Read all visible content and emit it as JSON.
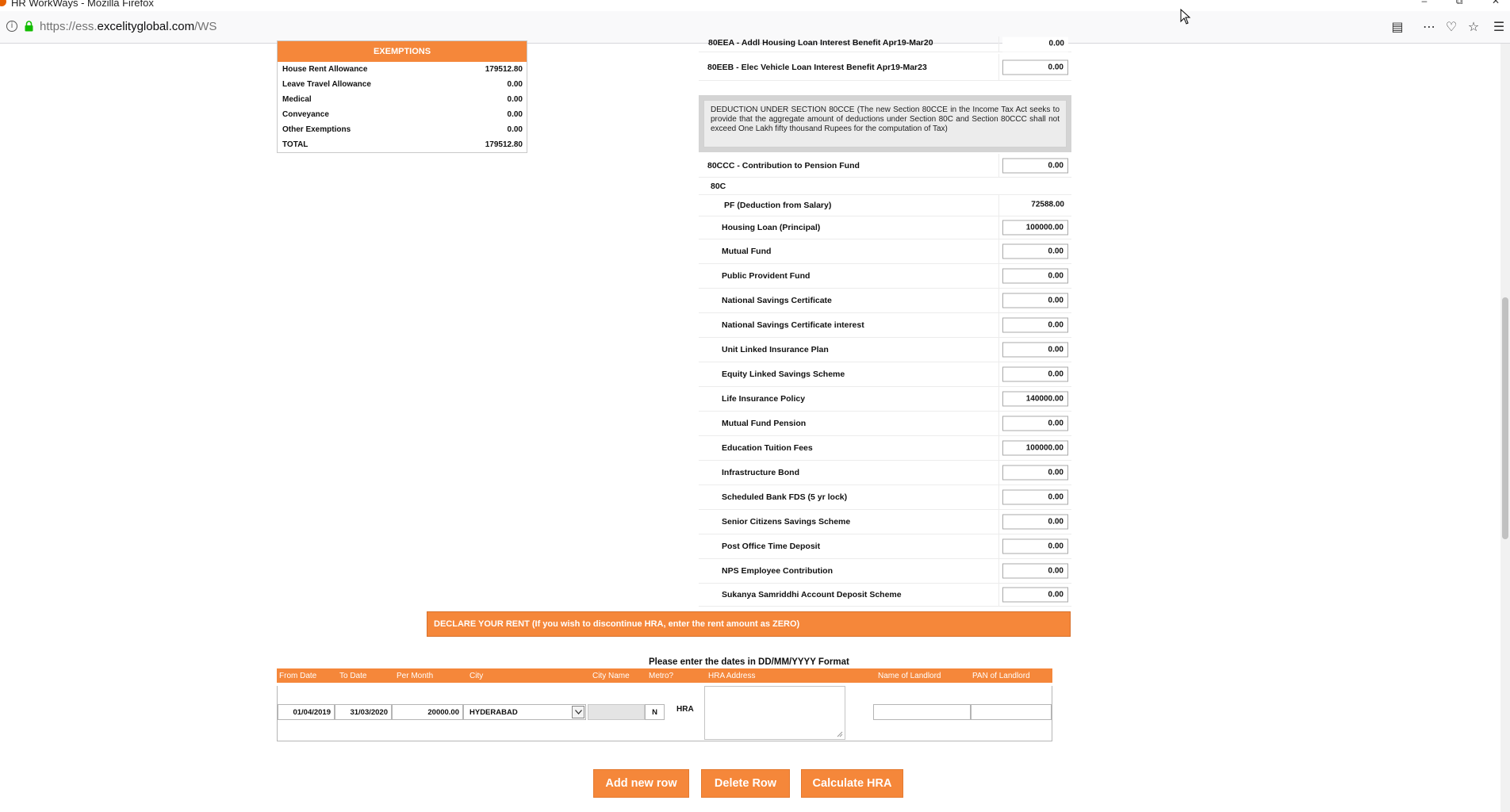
{
  "window": {
    "title": "HR WorkWays - Mozilla Firefox",
    "url_prefix": "https://ess.",
    "url_domain": "excelityglobal.com",
    "url_path": "/WS"
  },
  "exemptions": {
    "heading": "EXEMPTIONS",
    "rows": [
      {
        "label": "House Rent Allowance",
        "value": "179512.80"
      },
      {
        "label": "Leave Travel Allowance",
        "value": "0.00"
      },
      {
        "label": "Medical",
        "value": "0.00"
      },
      {
        "label": "Conveyance",
        "value": "0.00"
      },
      {
        "label": "Other Exemptions",
        "value": "0.00"
      },
      {
        "label": "TOTAL",
        "value": "179512.80"
      }
    ]
  },
  "deductions": {
    "top_partial": {
      "label": "80EEA - Addl Housing Loan Interest Benefit Apr19-Mar20",
      "value": "0.00"
    },
    "eeb": {
      "label": "80EEB - Elec Vehicle Loan Interest Benefit Apr19-Mar23",
      "value": "0.00"
    },
    "note": "DEDUCTION UNDER SECTION 80CCE (The new Section 80CCE in the Income Tax Act seeks to provide that the aggregate amount of deductions under Section 80C and Section 80CCC shall not exceed One Lakh fifty thousand Rupees for the computation of Tax)",
    "ccc": {
      "label": "80CCC - Contribution to Pension Fund",
      "value": "0.00"
    },
    "section_80c_label": "80C",
    "pf": {
      "label": "PF (Deduction from Salary)",
      "value": "72588.00"
    },
    "items": [
      {
        "label": "Housing Loan (Principal)",
        "value": "100000.00"
      },
      {
        "label": "Mutual Fund",
        "value": "0.00"
      },
      {
        "label": "Public Provident Fund",
        "value": "0.00"
      },
      {
        "label": "National Savings Certificate",
        "value": "0.00"
      },
      {
        "label": "National Savings Certificate interest",
        "value": "0.00"
      },
      {
        "label": "Unit Linked Insurance Plan",
        "value": "0.00"
      },
      {
        "label": "Equity Linked Savings Scheme",
        "value": "0.00"
      },
      {
        "label": "Life Insurance Policy",
        "value": "140000.00"
      },
      {
        "label": "Mutual Fund Pension",
        "value": "0.00"
      },
      {
        "label": "Education Tuition Fees",
        "value": "100000.00"
      },
      {
        "label": "Infrastructure Bond",
        "value": "0.00"
      },
      {
        "label": "Scheduled Bank FDS (5 yr lock)",
        "value": "0.00"
      },
      {
        "label": "Senior Citizens Savings Scheme",
        "value": "0.00"
      },
      {
        "label": "Post Office Time Deposit",
        "value": "0.00"
      },
      {
        "label": "NPS Employee Contribution",
        "value": "0.00"
      },
      {
        "label": "Sukanya Samriddhi Account Deposit Scheme",
        "value": "0.00"
      }
    ]
  },
  "rent": {
    "banner": "DECLARE YOUR RENT (If you wish to discontinue HRA, enter the rent amount as ZERO)",
    "date_note": "Please enter the dates in DD/MM/YYYY Format",
    "headers": {
      "from_date": "From Date",
      "to_date": "To Date",
      "per_month": "Per Month",
      "city": "City",
      "city_name": "City Name",
      "metro": "Metro?",
      "hra_address": "HRA Address",
      "landlord": "Name of Landlord",
      "pan": "PAN of Landlord"
    },
    "row": {
      "from_date": "01/04/2019",
      "to_date": "31/03/2020",
      "per_month": "20000.00",
      "city": "HYDERABAD",
      "city_name": "",
      "metro": "N",
      "type": "HRA",
      "address": "",
      "landlord": "",
      "pan": ""
    }
  },
  "buttons": {
    "add_row": "Add new row",
    "delete_row": "Delete Row",
    "calculate": "Calculate HRA"
  },
  "colors": {
    "accent": "#f5873a"
  }
}
